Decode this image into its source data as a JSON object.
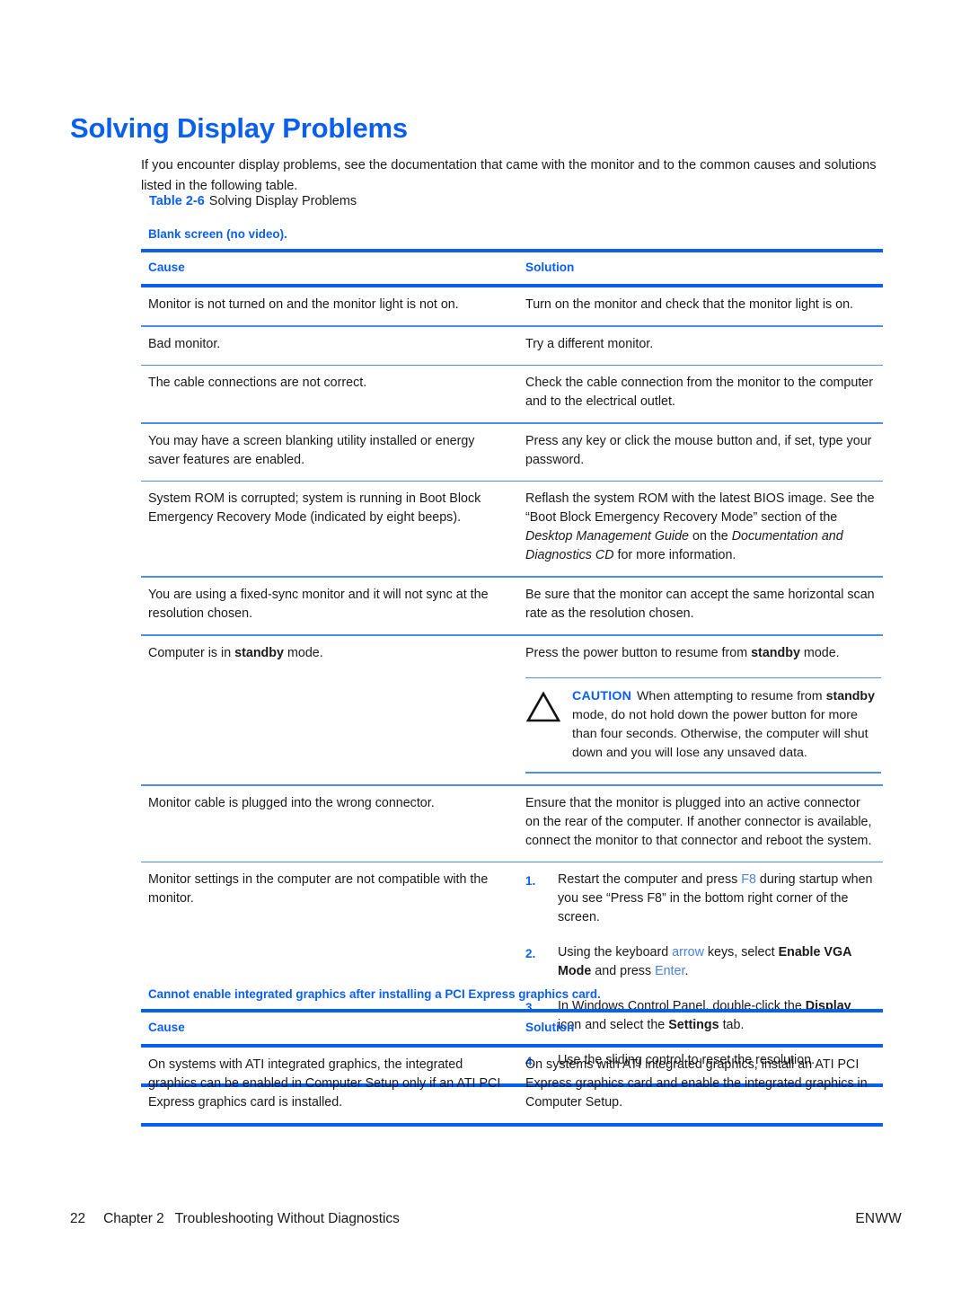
{
  "page": {
    "heading": "Solving Display Problems",
    "intro": "If you encounter display problems, see the documentation that came with the monitor and to the common causes and solutions listed in the following table.",
    "accent_color": "#0B5FEF",
    "key_link_color": "#4A82DE",
    "rule_color": "#4E8EE8"
  },
  "table_caption": {
    "number": "Table 2-6",
    "title": "Solving Display Problems"
  },
  "tables": [
    {
      "title": "Blank screen (no video).",
      "headers": {
        "cause": "Cause",
        "solution": "Solution"
      },
      "rows": [
        {
          "cause": "Monitor is not turned on and the monitor light is not on.",
          "solution": "Turn on the monitor and check that the monitor light is on."
        },
        {
          "cause": "Bad monitor.",
          "solution": "Try a different monitor."
        },
        {
          "cause": "The cable connections are not correct.",
          "solution": "Check the cable connection from the monitor to the computer and to the electrical outlet."
        },
        {
          "cause": "You may have a screen blanking utility installed or energy saver features are enabled.",
          "solution": "Press any key or click the mouse button and, if set, type your password."
        },
        {
          "cause": "System ROM is corrupted; system is running in Boot Block Emergency Recovery Mode (indicated by eight beeps).",
          "solution_parts": [
            {
              "text": "Reflash the system ROM with the latest BIOS image. See the “Boot Block Emergency Recovery Mode” section of the ",
              "style": "normal"
            },
            {
              "text": "Desktop Management Guide",
              "style": "italic"
            },
            {
              "text": " on the ",
              "style": "normal"
            },
            {
              "text": "Documentation and Diagnostics CD",
              "style": "italic"
            },
            {
              "text": " for more information.",
              "style": "normal"
            }
          ]
        },
        {
          "cause": "You are using a fixed-sync monitor and it will not sync at the resolution chosen.",
          "solution": "Be sure that the monitor can accept the same horizontal scan rate as the resolution chosen."
        },
        {
          "cause_parts": [
            {
              "text": "Computer is in ",
              "style": "normal"
            },
            {
              "text": "standby",
              "style": "bold"
            },
            {
              "text": " mode.",
              "style": "normal"
            }
          ],
          "solution_parts": [
            {
              "text": "Press the power button to resume from ",
              "style": "normal"
            },
            {
              "text": "standby",
              "style": "bold"
            },
            {
              "text": " mode.",
              "style": "normal"
            }
          ],
          "note": {
            "icon": "caution-triangle-icon",
            "label": "CAUTION",
            "parts": [
              {
                "text": "When attempting to resume from ",
                "style": "normal"
              },
              {
                "text": "standby",
                "style": "bold"
              },
              {
                "text": " mode, do not hold down the power button for more than four seconds. Otherwise, the computer will shut down and you will lose any unsaved data.",
                "style": "normal"
              }
            ]
          }
        },
        {
          "cause": "Monitor cable is plugged into the wrong connector.",
          "solution": "Ensure that the monitor is plugged into an active connector on the rear of the computer. If another connector is available, connect the monitor to that connector and reboot the system."
        },
        {
          "cause": "Monitor settings in the computer are not compatible with the monitor.",
          "steps": [
            {
              "num": "1.",
              "parts": [
                {
                  "text": "Restart the computer and press ",
                  "style": "normal"
                },
                {
                  "text": "F8",
                  "style": "key"
                },
                {
                  "text": " during startup when you see “Press F8” in the bottom right corner of the screen.",
                  "style": "normal"
                }
              ]
            },
            {
              "num": "2.",
              "parts": [
                {
                  "text": "Using the keyboard ",
                  "style": "normal"
                },
                {
                  "text": "arrow",
                  "style": "key"
                },
                {
                  "text": " keys, select ",
                  "style": "normal"
                },
                {
                  "text": "Enable VGA Mode",
                  "style": "bold"
                },
                {
                  "text": " and press ",
                  "style": "normal"
                },
                {
                  "text": "Enter",
                  "style": "key"
                },
                {
                  "text": ".",
                  "style": "normal"
                }
              ]
            },
            {
              "num": "3.",
              "parts": [
                {
                  "text": "In Windows Control Panel, double-click the ",
                  "style": "normal"
                },
                {
                  "text": "Display",
                  "style": "bold"
                },
                {
                  "text": " icon and select the ",
                  "style": "normal"
                },
                {
                  "text": "Settings",
                  "style": "bold"
                },
                {
                  "text": " tab.",
                  "style": "normal"
                }
              ]
            },
            {
              "num": "4.",
              "parts": [
                {
                  "text": "Use the sliding control to reset the resolution.",
                  "style": "normal"
                }
              ]
            }
          ]
        }
      ]
    },
    {
      "title": "Cannot enable integrated graphics after installing a PCI Express graphics card.",
      "headers": {
        "cause": "Cause",
        "solution": "Solution"
      },
      "rows": [
        {
          "cause": "On systems with ATI integrated graphics, the integrated graphics can be enabled in Computer Setup only if an ATI PCI Express graphics card is installed.",
          "solution": "On systems with ATI integrated graphics, install an ATI PCI Express graphics card and enable the integrated graphics in Computer Setup."
        }
      ]
    }
  ],
  "footer": {
    "page_number": "22",
    "chapter": "Chapter 2",
    "chapter_title": "Troubleshooting Without Diagnostics",
    "locale": "ENWW"
  }
}
